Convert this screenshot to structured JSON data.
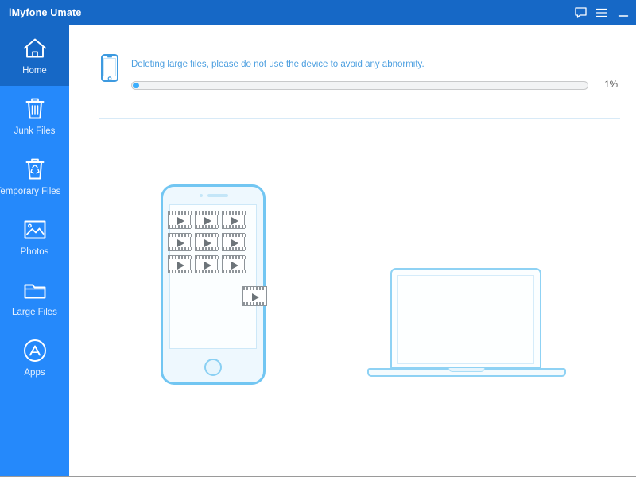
{
  "titlebar": {
    "title": "iMyfone Umate",
    "controls": [
      {
        "name": "feedback-icon",
        "label": "Feedback"
      },
      {
        "name": "menu-icon",
        "label": "Menu"
      },
      {
        "name": "minimize-icon",
        "label": "Minimize"
      }
    ]
  },
  "sidebar": {
    "items": [
      {
        "label": "Home",
        "icon": "home-icon",
        "active": true
      },
      {
        "label": "Junk Files",
        "icon": "trash-icon",
        "active": false
      },
      {
        "label": "Temporary Files",
        "icon": "recycle-trash-icon",
        "active": false
      },
      {
        "label": "Photos",
        "icon": "photo-icon",
        "active": false
      },
      {
        "label": "Large Files",
        "icon": "folder-icon",
        "active": false
      },
      {
        "label": "Apps",
        "icon": "app-store-icon",
        "active": false
      }
    ]
  },
  "status": {
    "message": "Deleting large files, please do not use the device to avoid any abnormity.",
    "device_icon": "phone-icon",
    "progress_percent_label": "1%",
    "progress_percent_value": 1
  },
  "illustration": {
    "phone": {
      "name": "phone-illustration",
      "video_thumbnail_count": 9,
      "thumbnail_icon": "video-file-icon",
      "floating_file_icon": "video-file-icon"
    },
    "laptop": {
      "name": "laptop-illustration"
    }
  },
  "colors": {
    "titlebar_blue": "#1668c6",
    "sidebar_blue": "#2589fb",
    "sidebar_active_blue": "#1668c6",
    "accent_text_blue": "#4c9fe0",
    "progress_fill": "#3daefc",
    "illustration_outline": "#72c6f2"
  }
}
